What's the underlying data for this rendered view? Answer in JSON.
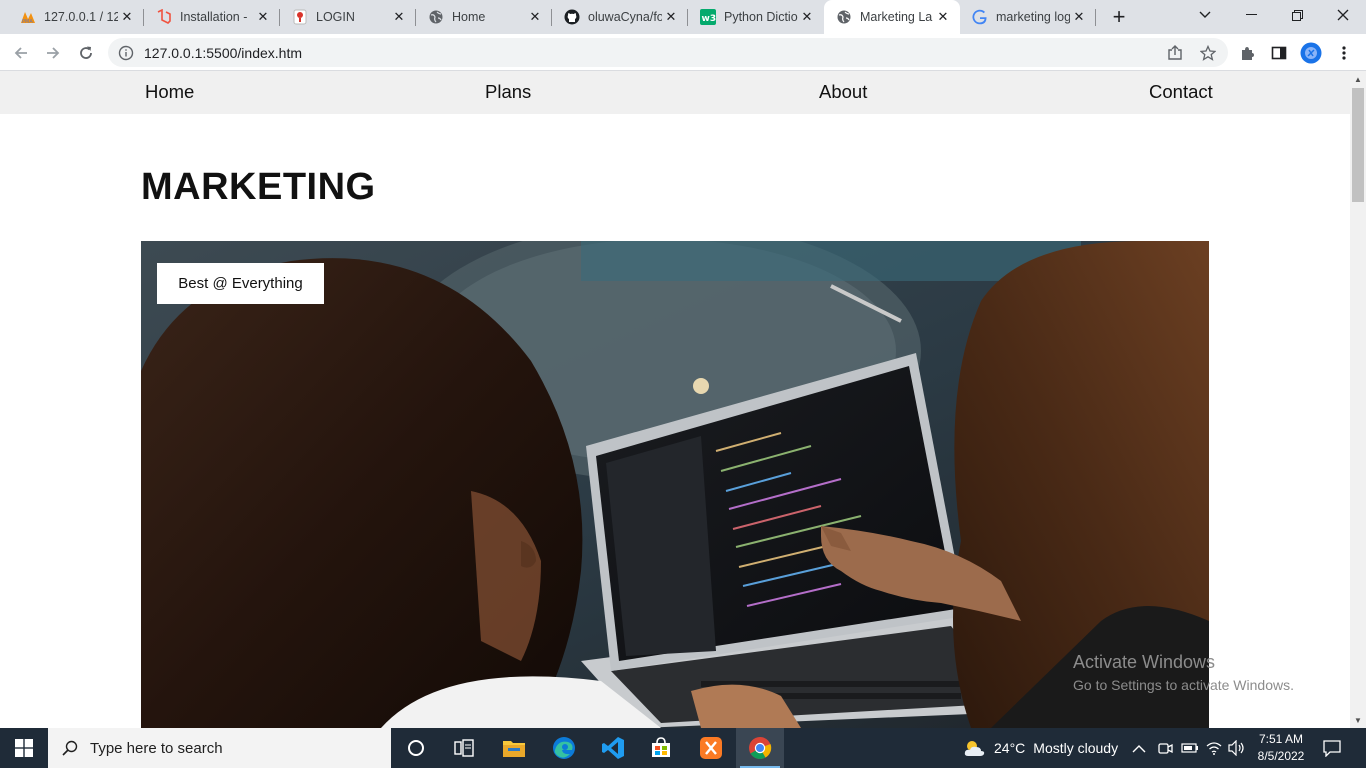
{
  "browser": {
    "tabs": [
      {
        "title": "127.0.0.1 / 12",
        "icon": "phpmyadmin-icon"
      },
      {
        "title": "Installation - ",
        "icon": "laravel-icon"
      },
      {
        "title": "LOGIN",
        "icon": "login-page-icon"
      },
      {
        "title": "Home",
        "icon": "globe-icon"
      },
      {
        "title": "oluwaCyna/fo",
        "icon": "github-icon"
      },
      {
        "title": "Python Dictio",
        "icon": "w3schools-icon"
      },
      {
        "title": "Marketing La",
        "icon": "globe-icon",
        "active": true
      },
      {
        "title": "marketing log",
        "icon": "google-icon"
      }
    ],
    "url": "127.0.0.1:5500/index.htm"
  },
  "site": {
    "nav": [
      "Home",
      "Plans",
      "About",
      "Contact"
    ],
    "title": "MARKETING",
    "hero_tag": "Best @ Everything",
    "hero_image_alt": "two women looking at a laptop showing code"
  },
  "watermark": {
    "line1": "Activate Windows",
    "line2": "Go to Settings to activate Windows."
  },
  "taskbar": {
    "search_placeholder": "Type here to search",
    "weather_temp": "24°C",
    "weather_text": "Mostly cloudy",
    "time": "7:51 AM",
    "date": "8/5/2022"
  },
  "colors": {
    "tabstrip": "#dee1e6",
    "site_nav_bg": "#f0f0f0",
    "taskbar_bg": "#1f2b38"
  }
}
